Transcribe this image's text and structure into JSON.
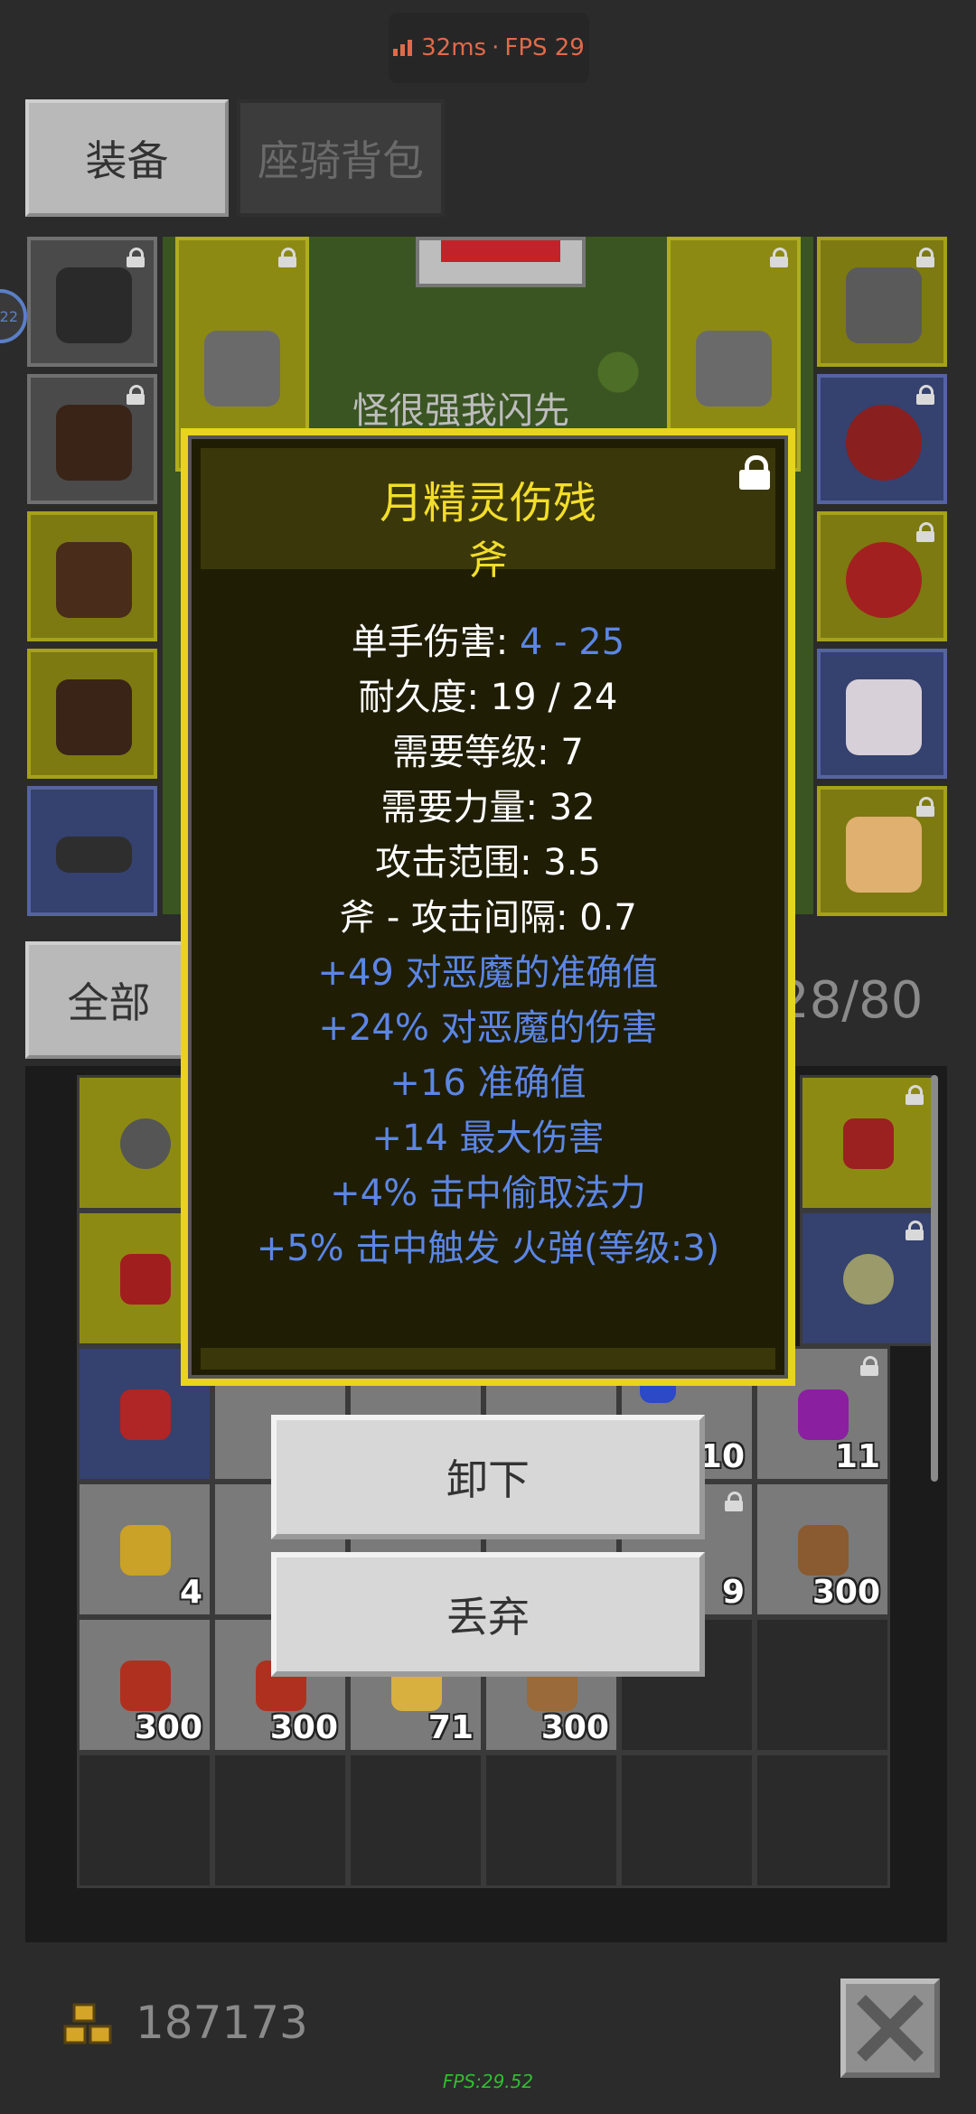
{
  "status": {
    "ping": "32ms",
    "separator": "·",
    "fps": "FPS 29"
  },
  "side_bubble": "22",
  "tabs": {
    "equipment": "装备",
    "mount_bag": "座骑背包"
  },
  "scene": {
    "text": "怪很强我闪先"
  },
  "filter": {
    "all": "全部"
  },
  "bag": {
    "count": "28/80"
  },
  "tooltip": {
    "name": "月精灵伤残",
    "type": "斧",
    "stats": [
      {
        "label": "单手伤害: ",
        "value": "4 - 25"
      },
      {
        "label": "耐久度: 19 / 24"
      },
      {
        "label": "需要等级: 7"
      },
      {
        "label": "需要力量: 32"
      },
      {
        "label": "攻击范围: 3.5"
      },
      {
        "label": "斧 - 攻击间隔: 0.7"
      }
    ],
    "affixes": [
      "+49 对恶魔的准确值",
      "+24% 对恶魔的伤害",
      "+16 准确值",
      "+14 最大伤害",
      "+4% 击中偷取法力",
      "+5% 击中触发 火弹(等级:3)"
    ]
  },
  "actions": {
    "unequip": "卸下",
    "discard": "丢弃"
  },
  "inventory": {
    "quantities": [
      "10",
      "11",
      "4",
      "9",
      "300",
      "300",
      "300",
      "71",
      "300"
    ]
  },
  "gold": {
    "amount": "187173"
  },
  "footer_fps": "FPS:29.52",
  "colors": {
    "rare_yellow": "#f2dd2a",
    "magic_blue": "#5b86e5",
    "fps_green": "#2fbe2f"
  }
}
